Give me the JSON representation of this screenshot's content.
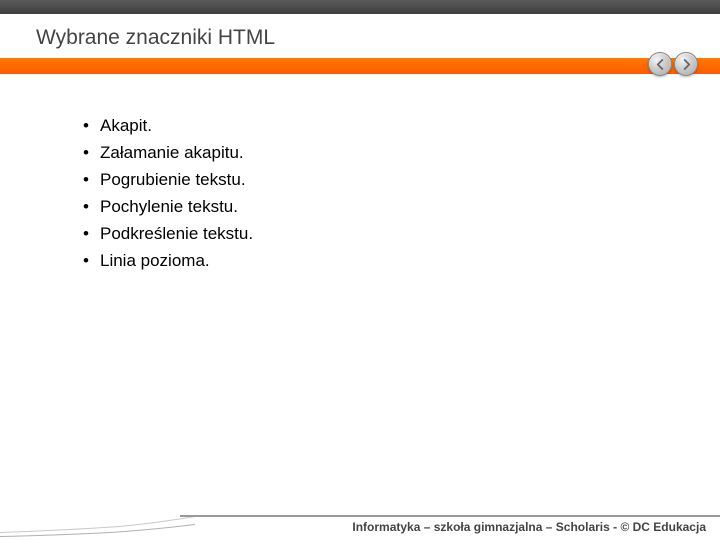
{
  "header": {
    "title": "Wybrane znaczniki HTML"
  },
  "content": {
    "bullets": [
      "Akapit.",
      "Załamanie akapitu.",
      "Pogrubienie tekstu.",
      "Pochylenie tekstu.",
      "Podkreślenie tekstu.",
      "Linia pozioma."
    ]
  },
  "footer": {
    "text": "Informatyka – szkoła gimnazjalna – Scholaris - © DC Edukacja"
  },
  "nav": {
    "prev": "prev",
    "next": "next"
  }
}
